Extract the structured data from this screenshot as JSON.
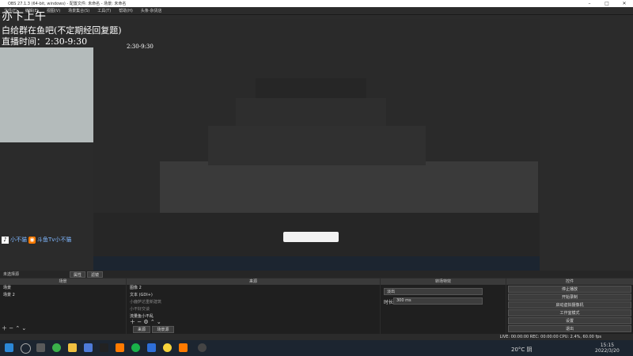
{
  "window": {
    "title": "OBS 27.1.3 (64-bit, windows) - 配置文件: 未命名 - 场景: 未命名",
    "minimize": "–",
    "maximize": "□",
    "close": "✕"
  },
  "menu": [
    "文件(F)",
    "编辑(E)",
    "视图(V)",
    "场景集合(S)",
    "工具(T)",
    "帮助(H)",
    "头条·杂货店"
  ],
  "overlay": {
    "line1": "亦卞上午",
    "line2": "白给群在鱼吧(不定期经回复题)",
    "line3": "直播时间：2:30-9:30",
    "small_line": "2:30-9:30",
    "brand1": "小不貓",
    "brand2": "斗鱼Tv小不猫"
  },
  "docks": {
    "status_bar_label": "未选择源",
    "properties_btn": "属性",
    "filters_btn": "滤镜",
    "scenes": {
      "header": "场景",
      "items": [
        "场景",
        "场景 2"
      ]
    },
    "sources": {
      "header": "来源",
      "items": [
        "图像 2",
        "文本 (GDI+)",
        "小鹿萨达重新建筑",
        "小不好交谈",
        "流量鱼小不乱"
      ],
      "tabs": [
        "来源",
        "场景源"
      ]
    },
    "transitions": {
      "header": "转场特效",
      "select": "淡出",
      "duration_label": "时长",
      "duration_value": "300 ms"
    },
    "controls": {
      "header": "控件",
      "buttons": [
        "停止播放",
        "开始录制",
        "启动虚拟摄像机",
        "工作室模式",
        "设置",
        "退出"
      ]
    }
  },
  "statusbar": {
    "text": "LIVE: 00:00:00   REC: 00:00:00   CPU: 2.4%, 60.00 fps"
  },
  "taskbar": {
    "weather": "20°C 阴",
    "time": "15:15",
    "date": "2022/3/20",
    "colors": {
      "start": "#2b88d8",
      "accent": "#ff7a00"
    }
  }
}
